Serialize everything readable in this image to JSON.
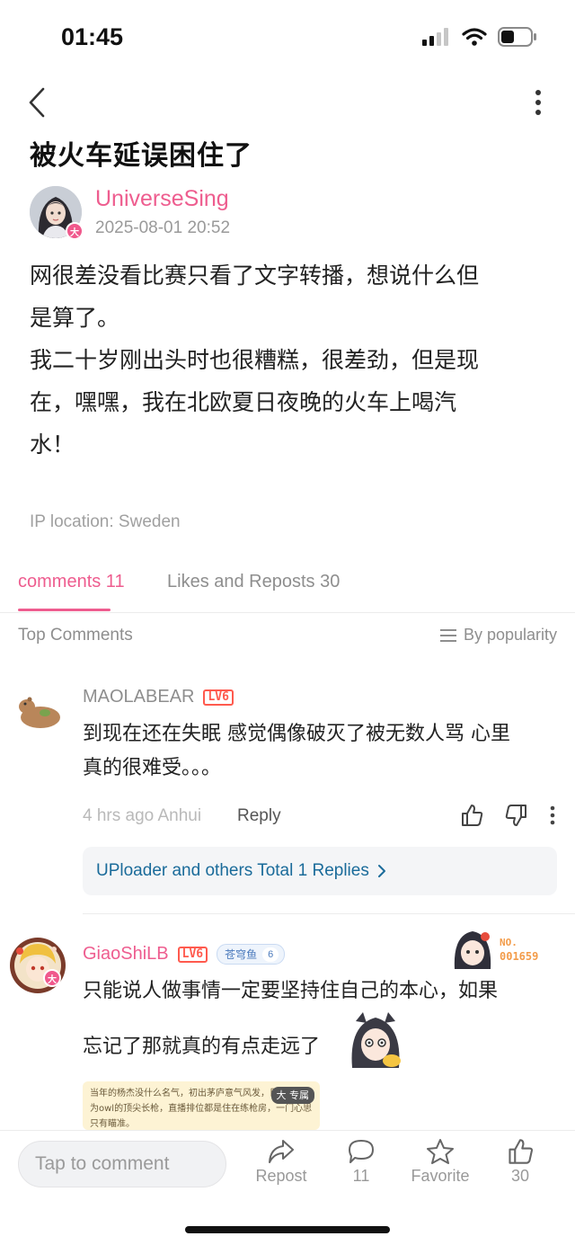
{
  "status_bar": {
    "time": "01:45"
  },
  "post": {
    "title": "被火车延误困住了",
    "author": "UniverseSing",
    "author_badge": "大",
    "timestamp": "2025-08-01 20:52",
    "body_lines": [
      "网很差没看比赛只看了文字转播，想说什么但",
      "是算了。",
      "我二十岁刚出头时也很糟糕，很差劲，但是现",
      "在，嘿嘿，我在北欧夏日夜晚的火车上喝汽",
      "水！"
    ],
    "ip_location": "IP location: Sweden"
  },
  "tabs": {
    "comments": "comments 11",
    "likes": "Likes and Reposts 30"
  },
  "sort": {
    "label": "Top Comments",
    "option": "By popularity"
  },
  "comments": [
    {
      "user": "MAOLABEAR",
      "level": "LV6",
      "text_lines": [
        "到现在还在失眠 感觉偶像破灭了被无数人骂 心里",
        "真的很难受。。。"
      ],
      "meta": "4 hrs ago Anhui",
      "reply": "Reply",
      "replies_summary": "UPloader and others Total 1 Replies"
    },
    {
      "user": "GiaoShiLB",
      "level": "LV6",
      "badge": "大",
      "fan_badge": "苍穹鱼",
      "fan_level": "6",
      "decor_no_label": "NO.",
      "decor_no": "001659",
      "text_lines": [
        "只能说人做事情一定要坚持住自己的本心，如果",
        "忘记了那就真的有点走远了"
      ],
      "card_text": "当年的杨杰没什么名气，初出茅庐意气风发，目标是成为owl的顶尖长枪，直播排位都是住在练枪房，一门心思只有瞄准。",
      "card_tag": "专属",
      "card_tag_badge": "大"
    }
  ],
  "bottom_bar": {
    "input_placeholder": "Tap to comment",
    "repost": "Repost",
    "comment_count": "11",
    "favorite": "Favorite",
    "like_count": "30"
  },
  "colors": {
    "accent": "#ee5d8f",
    "link": "#1a6b9a",
    "level_badge": "#ff5a4e"
  }
}
